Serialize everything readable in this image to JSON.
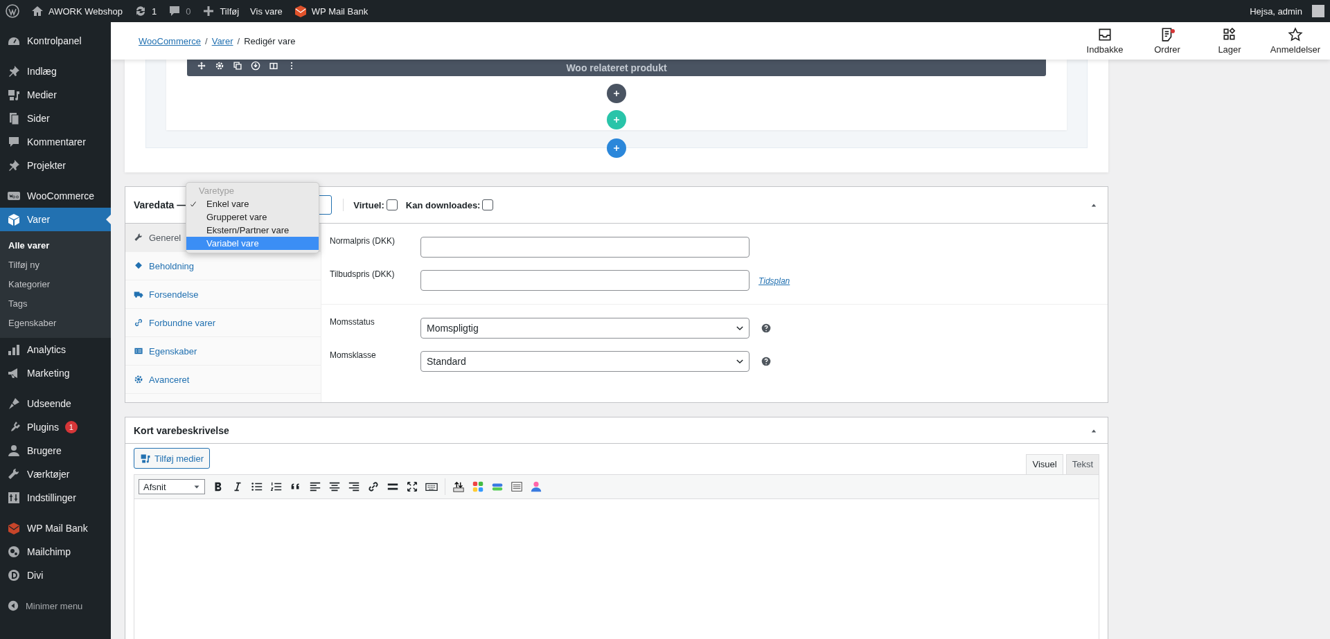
{
  "admin_bar": {
    "site": "AWORK Webshop",
    "updates": "1",
    "comments": "0",
    "new": "Tilføj",
    "view": "Vis vare",
    "plugin": "WP Mail Bank",
    "greeting": "Hejsa, admin"
  },
  "sidebar": {
    "groups": [
      [
        {
          "label": "Kontrolpanel",
          "selected": false
        }
      ],
      [
        {
          "label": "Indlæg",
          "selected": false
        },
        {
          "label": "Medier",
          "selected": false
        },
        {
          "label": "Sider",
          "selected": false
        },
        {
          "label": "Kommentarer",
          "selected": false
        },
        {
          "label": "Projekter",
          "selected": false
        }
      ],
      [
        {
          "label": "WooCommerce",
          "selected": false
        },
        {
          "label": "Varer",
          "selected": true,
          "children": [
            {
              "label": "Alle varer",
              "selected": true
            },
            {
              "label": "Tilføj ny",
              "selected": false
            },
            {
              "label": "Kategorier",
              "selected": false
            },
            {
              "label": "Tags",
              "selected": false
            },
            {
              "label": "Egenskaber",
              "selected": false
            }
          ]
        },
        {
          "label": "Analytics",
          "selected": false
        },
        {
          "label": "Marketing",
          "selected": false
        }
      ],
      [
        {
          "label": "Udseende",
          "selected": false
        },
        {
          "label": "Plugins",
          "selected": false,
          "badge": "1"
        },
        {
          "label": "Brugere",
          "selected": false
        },
        {
          "label": "Værktøjer",
          "selected": false
        },
        {
          "label": "Indstillinger",
          "selected": false
        }
      ],
      [
        {
          "label": "WP Mail Bank",
          "selected": false
        },
        {
          "label": "Mailchimp",
          "selected": false
        },
        {
          "label": "Divi",
          "selected": false
        }
      ]
    ],
    "collapse": "Minimer menu"
  },
  "header": {
    "breadcrumbs": [
      {
        "label": "WooCommerce",
        "link": true
      },
      {
        "label": "Varer",
        "link": true,
        "separator": "/"
      },
      {
        "label": "Redigér vare",
        "link": false,
        "separator": "/"
      }
    ],
    "actions": [
      {
        "label": "Indbakke",
        "notification": false
      },
      {
        "label": "Ordrer",
        "notification": true
      },
      {
        "label": "Lager",
        "notification": false
      },
      {
        "label": "Anmeldelser",
        "notification": false
      }
    ]
  },
  "builder": {
    "module_title": "Woo relateret produkt"
  },
  "product_data": {
    "title": "Varedata —",
    "type_menu": {
      "heading": "Varetype",
      "options": [
        {
          "label": "Enkel vare",
          "checked": true,
          "selected": false
        },
        {
          "label": "Grupperet vare",
          "checked": false,
          "selected": false
        },
        {
          "label": "Ekstern/Partner vare",
          "checked": false,
          "selected": false
        },
        {
          "label": "Variabel vare",
          "checked": false,
          "selected": true
        }
      ]
    },
    "options": [
      {
        "label": "Virtuel:",
        "checked": false
      },
      {
        "label": "Kan downloades:",
        "checked": false
      }
    ],
    "tabs": [
      {
        "label": "Generel",
        "selected": true
      },
      {
        "label": "Beholdning",
        "selected": false
      },
      {
        "label": "Forsendelse",
        "selected": false
      },
      {
        "label": "Forbundne varer",
        "selected": false
      },
      {
        "label": "Egenskaber",
        "selected": false
      },
      {
        "label": "Avanceret",
        "selected": false
      }
    ],
    "sections": [
      [
        {
          "kind": "input",
          "label": "Normalpris (DKK)"
        },
        {
          "kind": "input",
          "label": "Tilbudspris (DKK)",
          "link": "Tidsplan"
        }
      ],
      [
        {
          "kind": "select",
          "label": "Momsstatus",
          "value": "Momspligtig"
        },
        {
          "kind": "select",
          "label": "Momsklasse",
          "value": "Standard"
        }
      ]
    ]
  },
  "short_description": {
    "title": "Kort varebeskrivelse",
    "add_media": "Tilføj medier",
    "editor_tabs": [
      {
        "label": "Visuel",
        "selected": true
      },
      {
        "label": "Tekst",
        "selected": false
      }
    ],
    "format": "Afsnit"
  }
}
